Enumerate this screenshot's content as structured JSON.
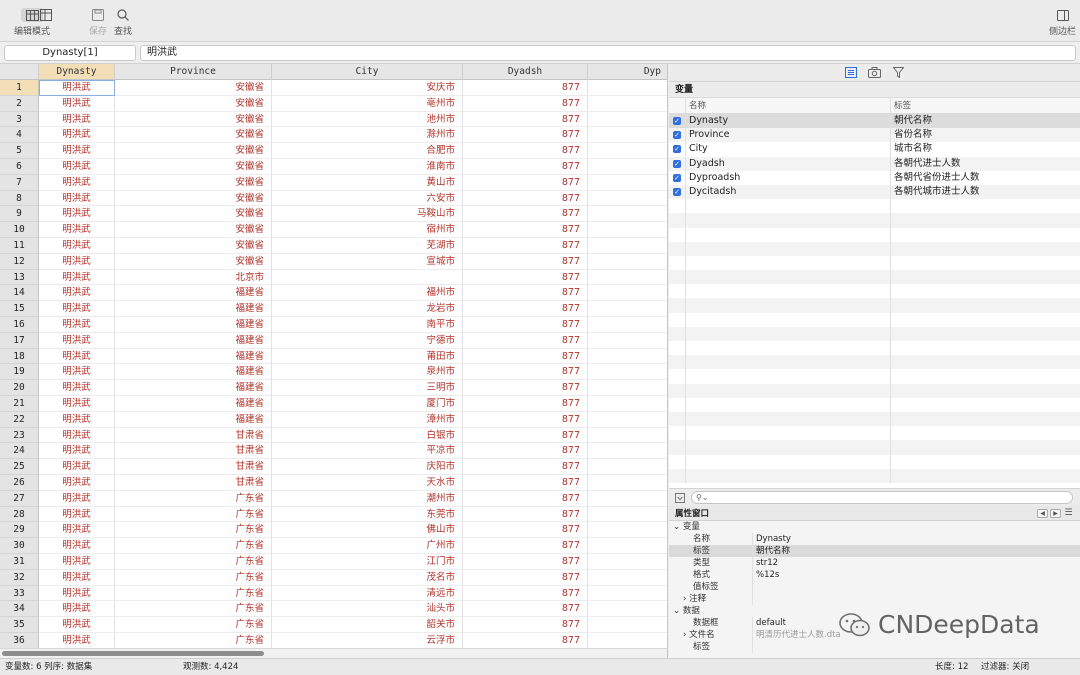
{
  "toolbar": {
    "edit_mode": "编辑模式",
    "save": "保存",
    "find": "查找",
    "sidebar": "侧边栏"
  },
  "cmdbar": {
    "cell_ref": "Dynasty[1]",
    "cell_value": "明洪武"
  },
  "grid": {
    "columns": [
      "Dynasty",
      "Province",
      "City",
      "Dyadsh",
      "Dyp"
    ],
    "rows": [
      [
        "1",
        "明洪武",
        "安徽省",
        "安庆市",
        "877"
      ],
      [
        "2",
        "明洪武",
        "安徽省",
        "亳州市",
        "877"
      ],
      [
        "3",
        "明洪武",
        "安徽省",
        "池州市",
        "877"
      ],
      [
        "4",
        "明洪武",
        "安徽省",
        "滁州市",
        "877"
      ],
      [
        "5",
        "明洪武",
        "安徽省",
        "合肥市",
        "877"
      ],
      [
        "6",
        "明洪武",
        "安徽省",
        "淮南市",
        "877"
      ],
      [
        "7",
        "明洪武",
        "安徽省",
        "黄山市",
        "877"
      ],
      [
        "8",
        "明洪武",
        "安徽省",
        "六安市",
        "877"
      ],
      [
        "9",
        "明洪武",
        "安徽省",
        "马鞍山市",
        "877"
      ],
      [
        "10",
        "明洪武",
        "安徽省",
        "宿州市",
        "877"
      ],
      [
        "11",
        "明洪武",
        "安徽省",
        "芜湖市",
        "877"
      ],
      [
        "12",
        "明洪武",
        "安徽省",
        "宣城市",
        "877"
      ],
      [
        "13",
        "明洪武",
        "北京市",
        "",
        "877"
      ],
      [
        "14",
        "明洪武",
        "福建省",
        "福州市",
        "877"
      ],
      [
        "15",
        "明洪武",
        "福建省",
        "龙岩市",
        "877"
      ],
      [
        "16",
        "明洪武",
        "福建省",
        "南平市",
        "877"
      ],
      [
        "17",
        "明洪武",
        "福建省",
        "宁德市",
        "877"
      ],
      [
        "18",
        "明洪武",
        "福建省",
        "莆田市",
        "877"
      ],
      [
        "19",
        "明洪武",
        "福建省",
        "泉州市",
        "877"
      ],
      [
        "20",
        "明洪武",
        "福建省",
        "三明市",
        "877"
      ],
      [
        "21",
        "明洪武",
        "福建省",
        "厦门市",
        "877"
      ],
      [
        "22",
        "明洪武",
        "福建省",
        "漳州市",
        "877"
      ],
      [
        "23",
        "明洪武",
        "甘肃省",
        "白银市",
        "877"
      ],
      [
        "24",
        "明洪武",
        "甘肃省",
        "平凉市",
        "877"
      ],
      [
        "25",
        "明洪武",
        "甘肃省",
        "庆阳市",
        "877"
      ],
      [
        "26",
        "明洪武",
        "甘肃省",
        "天水市",
        "877"
      ],
      [
        "27",
        "明洪武",
        "广东省",
        "潮州市",
        "877"
      ],
      [
        "28",
        "明洪武",
        "广东省",
        "东莞市",
        "877"
      ],
      [
        "29",
        "明洪武",
        "广东省",
        "佛山市",
        "877"
      ],
      [
        "30",
        "明洪武",
        "广东省",
        "广州市",
        "877"
      ],
      [
        "31",
        "明洪武",
        "广东省",
        "江门市",
        "877"
      ],
      [
        "32",
        "明洪武",
        "广东省",
        "茂名市",
        "877"
      ],
      [
        "33",
        "明洪武",
        "广东省",
        "清远市",
        "877"
      ],
      [
        "34",
        "明洪武",
        "广东省",
        "汕头市",
        "877"
      ],
      [
        "35",
        "明洪武",
        "广东省",
        "韶关市",
        "877"
      ],
      [
        "36",
        "明洪武",
        "广东省",
        "云浮市",
        "877"
      ]
    ]
  },
  "variables": {
    "title": "变量",
    "col_name": "名称",
    "col_label": "标签",
    "items": [
      {
        "name": "Dynasty",
        "label": "朝代名称"
      },
      {
        "name": "Province",
        "label": "省份名称"
      },
      {
        "name": "City",
        "label": "城市名称"
      },
      {
        "name": "Dyadsh",
        "label": "各朝代进士人数"
      },
      {
        "name": "Dyproadsh",
        "label": "各朝代省份进士人数"
      },
      {
        "name": "Dycitadsh",
        "label": "各朝代城市进士人数"
      }
    ]
  },
  "properties": {
    "title": "属性窗口",
    "var_group": "变量",
    "var_props": [
      {
        "k": "名称",
        "v": "Dynasty"
      },
      {
        "k": "标签",
        "v": "朝代名称"
      },
      {
        "k": "类型",
        "v": "str12"
      },
      {
        "k": "格式",
        "v": "%12s"
      },
      {
        "k": "值标签",
        "v": ""
      },
      {
        "k": "注释",
        "v": ""
      }
    ],
    "data_group": "数据",
    "data_props": [
      {
        "k": "数据框",
        "v": "default"
      },
      {
        "k": "文件名",
        "v": "明清历代进士人数.dta"
      },
      {
        "k": "标签",
        "v": ""
      }
    ]
  },
  "status": {
    "vars": "变量数: 6  列序: 数据集",
    "obs": "观测数: 4,424",
    "length": "长度: 12",
    "filter": "过滤器: 关闭"
  },
  "watermark": "CNDeepData"
}
